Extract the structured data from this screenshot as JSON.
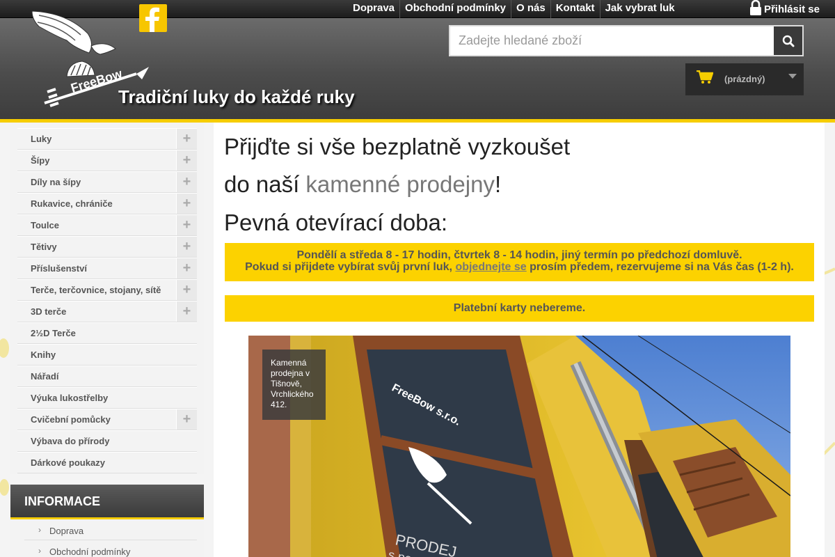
{
  "topnav": {
    "items": [
      "Doprava",
      "Obchodní podmínky",
      "O nás",
      "Kontakt",
      "Jak vybrat luk"
    ],
    "login_label": "Přihlásit se"
  },
  "header": {
    "logo_text": "FreeBow",
    "slogan": "Tradiční luky do každé ruky",
    "search_placeholder": "Zadejte hledané zboží",
    "cart_label": "(prázdný)"
  },
  "sidebar": {
    "categories": [
      {
        "label": "Luky",
        "expandable": true
      },
      {
        "label": "Šípy",
        "expandable": true
      },
      {
        "label": "Díly na šípy",
        "expandable": true
      },
      {
        "label": "Rukavice, chrániče",
        "expandable": true
      },
      {
        "label": "Toulce",
        "expandable": true
      },
      {
        "label": "Tětivy",
        "expandable": true
      },
      {
        "label": "Příslušenství",
        "expandable": true
      },
      {
        "label": "Terče, terčovnice, stojany, sítě",
        "expandable": true
      },
      {
        "label": "3D terče",
        "expandable": true
      },
      {
        "label": "2½D Terče",
        "expandable": false
      },
      {
        "label": "Knihy",
        "expandable": false
      },
      {
        "label": "Nářadí",
        "expandable": false
      },
      {
        "label": "Výuka lukostřelby",
        "expandable": false
      },
      {
        "label": "Cvičební pomůcky",
        "expandable": true
      },
      {
        "label": "Výbava do přírody",
        "expandable": false
      },
      {
        "label": "Dárkové poukazy",
        "expandable": false
      }
    ],
    "info_title": "INFORMACE",
    "info_items": [
      "Doprava",
      "Obchodní podmínky"
    ]
  },
  "main": {
    "heading1": "Přijďte si vše bezplatně vyzkoušet",
    "heading2_pre": "do naší ",
    "heading2_link": "kamenné prodejny",
    "heading2_post": "!",
    "heading3": "Pevná otevírací doba:",
    "notice1_line1": "Pondělí a středa 8 - 17 hodin, čtvrtek 8 - 14 hodin, jiný termín po předchozí domluvě.",
    "notice1_line2_pre": "Pokud si přijdete vybírat svůj první luk, ",
    "notice1_line2_link": "objednejte se",
    "notice1_line2_post": " prosím předem, rezervujeme si na Vás čas (1-2 h).",
    "notice2": "Platební karty nebereme.",
    "photo_caption": "Kamenná prodejna v Tišnově, Vrchlického 412.",
    "photo_sign_brand": "FreeBow s.r.o.",
    "photo_sign_text": "PRODEJ",
    "photo_sign_text2": "s po"
  },
  "colors": {
    "accent": "#fcd200",
    "topbar": "#262626",
    "header": "#555555"
  }
}
